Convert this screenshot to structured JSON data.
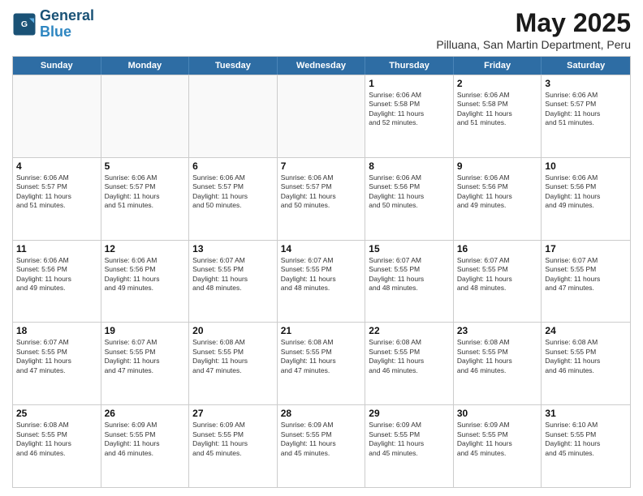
{
  "logo": {
    "line1": "General",
    "line2": "Blue"
  },
  "title": "May 2025",
  "subtitle": "Pilluana, San Martin Department, Peru",
  "days": [
    "Sunday",
    "Monday",
    "Tuesday",
    "Wednesday",
    "Thursday",
    "Friday",
    "Saturday"
  ],
  "weeks": [
    [
      {
        "day": "",
        "info": "",
        "empty": true
      },
      {
        "day": "",
        "info": "",
        "empty": true
      },
      {
        "day": "",
        "info": "",
        "empty": true
      },
      {
        "day": "",
        "info": "",
        "empty": true
      },
      {
        "day": "1",
        "info": "Sunrise: 6:06 AM\nSunset: 5:58 PM\nDaylight: 11 hours\nand 52 minutes."
      },
      {
        "day": "2",
        "info": "Sunrise: 6:06 AM\nSunset: 5:58 PM\nDaylight: 11 hours\nand 51 minutes."
      },
      {
        "day": "3",
        "info": "Sunrise: 6:06 AM\nSunset: 5:57 PM\nDaylight: 11 hours\nand 51 minutes."
      }
    ],
    [
      {
        "day": "4",
        "info": "Sunrise: 6:06 AM\nSunset: 5:57 PM\nDaylight: 11 hours\nand 51 minutes."
      },
      {
        "day": "5",
        "info": "Sunrise: 6:06 AM\nSunset: 5:57 PM\nDaylight: 11 hours\nand 51 minutes."
      },
      {
        "day": "6",
        "info": "Sunrise: 6:06 AM\nSunset: 5:57 PM\nDaylight: 11 hours\nand 50 minutes."
      },
      {
        "day": "7",
        "info": "Sunrise: 6:06 AM\nSunset: 5:57 PM\nDaylight: 11 hours\nand 50 minutes."
      },
      {
        "day": "8",
        "info": "Sunrise: 6:06 AM\nSunset: 5:56 PM\nDaylight: 11 hours\nand 50 minutes."
      },
      {
        "day": "9",
        "info": "Sunrise: 6:06 AM\nSunset: 5:56 PM\nDaylight: 11 hours\nand 49 minutes."
      },
      {
        "day": "10",
        "info": "Sunrise: 6:06 AM\nSunset: 5:56 PM\nDaylight: 11 hours\nand 49 minutes."
      }
    ],
    [
      {
        "day": "11",
        "info": "Sunrise: 6:06 AM\nSunset: 5:56 PM\nDaylight: 11 hours\nand 49 minutes."
      },
      {
        "day": "12",
        "info": "Sunrise: 6:06 AM\nSunset: 5:56 PM\nDaylight: 11 hours\nand 49 minutes."
      },
      {
        "day": "13",
        "info": "Sunrise: 6:07 AM\nSunset: 5:55 PM\nDaylight: 11 hours\nand 48 minutes."
      },
      {
        "day": "14",
        "info": "Sunrise: 6:07 AM\nSunset: 5:55 PM\nDaylight: 11 hours\nand 48 minutes."
      },
      {
        "day": "15",
        "info": "Sunrise: 6:07 AM\nSunset: 5:55 PM\nDaylight: 11 hours\nand 48 minutes."
      },
      {
        "day": "16",
        "info": "Sunrise: 6:07 AM\nSunset: 5:55 PM\nDaylight: 11 hours\nand 48 minutes."
      },
      {
        "day": "17",
        "info": "Sunrise: 6:07 AM\nSunset: 5:55 PM\nDaylight: 11 hours\nand 47 minutes."
      }
    ],
    [
      {
        "day": "18",
        "info": "Sunrise: 6:07 AM\nSunset: 5:55 PM\nDaylight: 11 hours\nand 47 minutes."
      },
      {
        "day": "19",
        "info": "Sunrise: 6:07 AM\nSunset: 5:55 PM\nDaylight: 11 hours\nand 47 minutes."
      },
      {
        "day": "20",
        "info": "Sunrise: 6:08 AM\nSunset: 5:55 PM\nDaylight: 11 hours\nand 47 minutes."
      },
      {
        "day": "21",
        "info": "Sunrise: 6:08 AM\nSunset: 5:55 PM\nDaylight: 11 hours\nand 47 minutes."
      },
      {
        "day": "22",
        "info": "Sunrise: 6:08 AM\nSunset: 5:55 PM\nDaylight: 11 hours\nand 46 minutes."
      },
      {
        "day": "23",
        "info": "Sunrise: 6:08 AM\nSunset: 5:55 PM\nDaylight: 11 hours\nand 46 minutes."
      },
      {
        "day": "24",
        "info": "Sunrise: 6:08 AM\nSunset: 5:55 PM\nDaylight: 11 hours\nand 46 minutes."
      }
    ],
    [
      {
        "day": "25",
        "info": "Sunrise: 6:08 AM\nSunset: 5:55 PM\nDaylight: 11 hours\nand 46 minutes."
      },
      {
        "day": "26",
        "info": "Sunrise: 6:09 AM\nSunset: 5:55 PM\nDaylight: 11 hours\nand 46 minutes."
      },
      {
        "day": "27",
        "info": "Sunrise: 6:09 AM\nSunset: 5:55 PM\nDaylight: 11 hours\nand 45 minutes."
      },
      {
        "day": "28",
        "info": "Sunrise: 6:09 AM\nSunset: 5:55 PM\nDaylight: 11 hours\nand 45 minutes."
      },
      {
        "day": "29",
        "info": "Sunrise: 6:09 AM\nSunset: 5:55 PM\nDaylight: 11 hours\nand 45 minutes."
      },
      {
        "day": "30",
        "info": "Sunrise: 6:09 AM\nSunset: 5:55 PM\nDaylight: 11 hours\nand 45 minutes."
      },
      {
        "day": "31",
        "info": "Sunrise: 6:10 AM\nSunset: 5:55 PM\nDaylight: 11 hours\nand 45 minutes."
      }
    ]
  ]
}
